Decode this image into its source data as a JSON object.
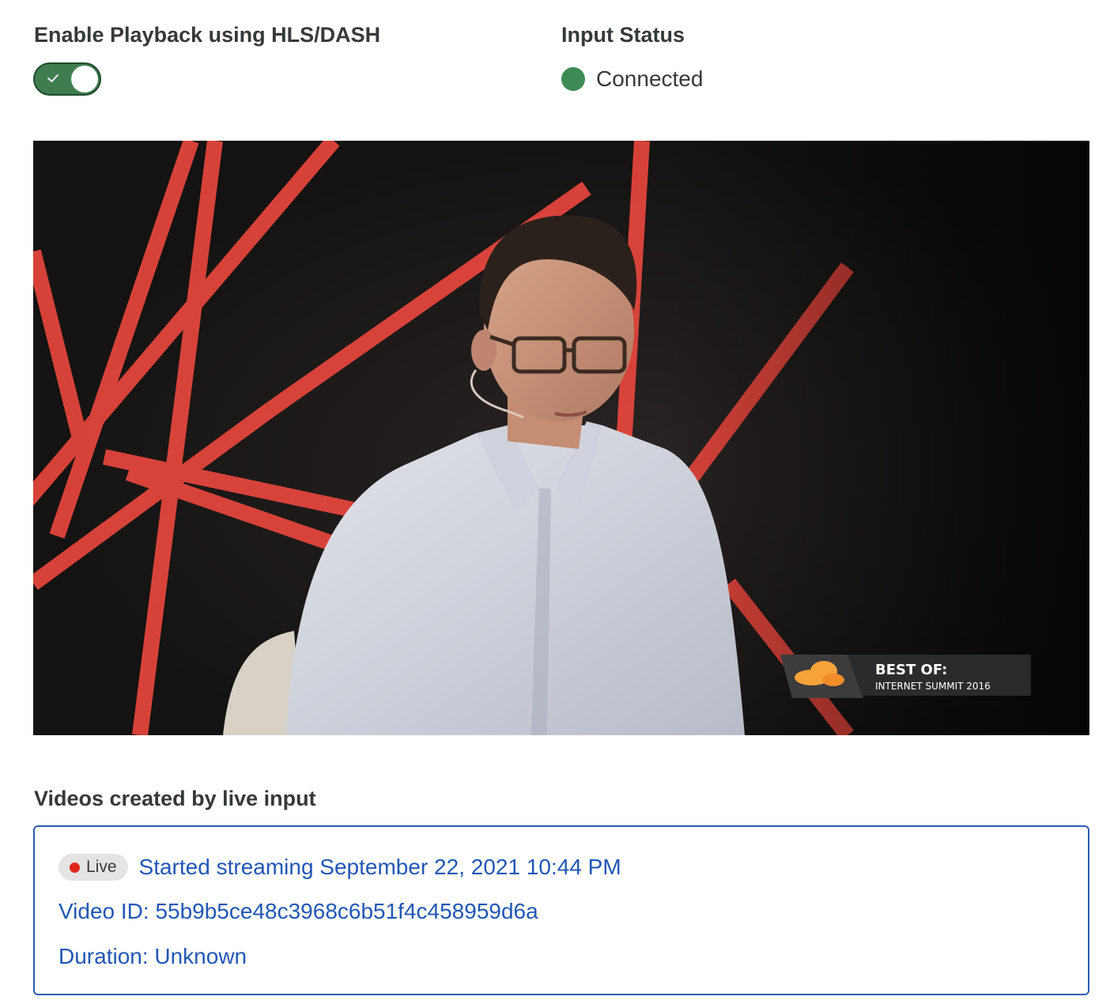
{
  "playback": {
    "label": "Enable Playback using HLS/DASH",
    "enabled": true
  },
  "input_status": {
    "label": "Input Status",
    "value": "Connected",
    "color": "#3e8a55"
  },
  "player": {
    "overlay_title": "BEST OF:",
    "overlay_subtitle": "INTERNET SUMMIT 2016"
  },
  "videos": {
    "heading": "Videos created by live input",
    "items": [
      {
        "badge": "Live",
        "started": "Started streaming September 22, 2021 10:44 PM",
        "video_id": "Video ID: 55b9b5ce48c3968c6b51f4c458959d6a",
        "duration": "Duration: Unknown"
      }
    ]
  },
  "colors": {
    "toggle_on": "#3f7d4f",
    "link": "#2157b5",
    "live_dot": "#e0251b",
    "accent_red": "#e8473c"
  }
}
